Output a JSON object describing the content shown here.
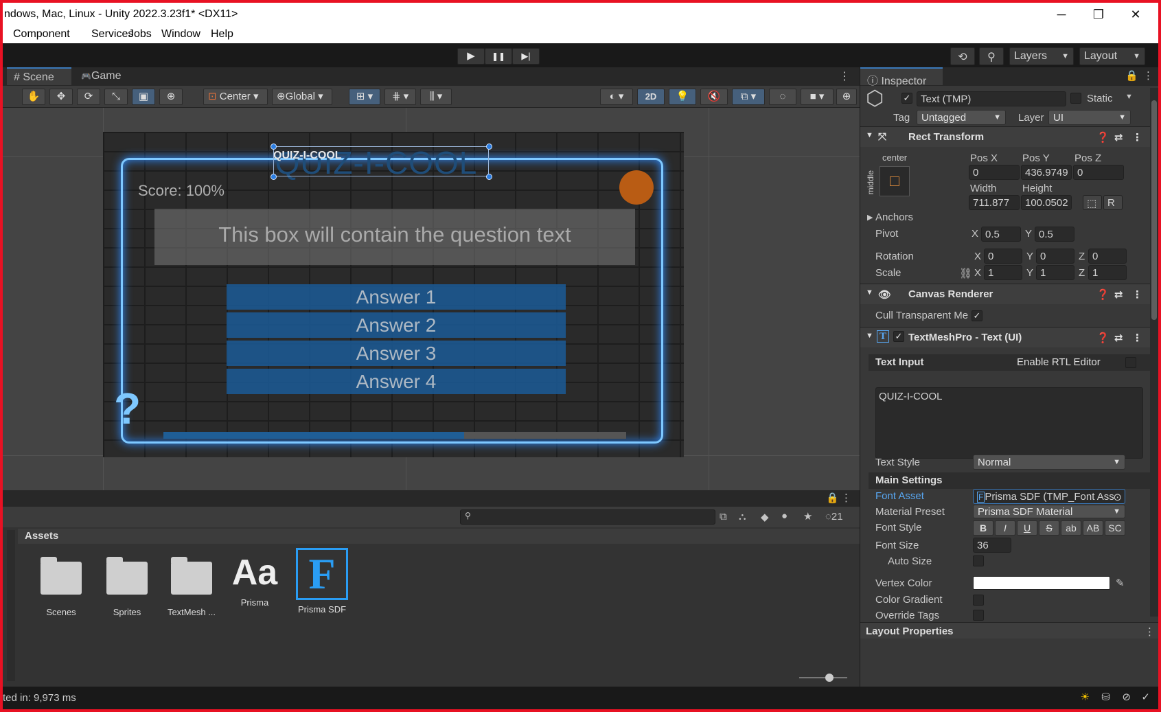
{
  "window": {
    "title": "ndows, Mac, Linux - Unity 2022.3.23f1* <DX11>",
    "minimize": "─",
    "maximize": "❐",
    "close": "✕"
  },
  "menu": [
    "Component",
    "Services",
    "Jobs",
    "Window",
    "Help"
  ],
  "toolbar": {
    "play": "▶",
    "pause": "❚❚",
    "step": "▶|",
    "history": "⟲",
    "search": "⚲",
    "layers": "Layers",
    "layout": "Layout"
  },
  "scene_tabs": [
    {
      "label": "Scene",
      "icon": "#"
    },
    {
      "label": "Game",
      "icon": "🎮"
    }
  ],
  "scene_toolbar": {
    "pivot": "Center",
    "space": "Global",
    "mode2d": "2D"
  },
  "game": {
    "title": "QUIZ-I-COOL",
    "logo": "QUIZ-I-COOL",
    "score": "Score: 100%",
    "question": "This box will contain the question text",
    "answers": [
      "Answer 1",
      "Answer 2",
      "Answer 3",
      "Answer 4"
    ],
    "qmark": "?",
    "progress": 0.65
  },
  "project": {
    "header": "Assets",
    "hidden_count": "21",
    "items": [
      "Scenes",
      "Sprites",
      "TextMesh ...",
      "Prisma",
      "Prisma SDF"
    ],
    "font_glyph": "Aa",
    "sdf_glyph": "F"
  },
  "status": {
    "text": "ted in: 9,973 ms"
  },
  "inspector": {
    "tab": "Inspector",
    "object_name": "Text (TMP)",
    "static_label": "Static",
    "tag_label": "Tag",
    "tag": "Untagged",
    "layer_label": "Layer",
    "layer": "UI",
    "rect": {
      "title": "Rect Transform",
      "anchor_h": "center",
      "anchor_v": "middle",
      "posx_l": "Pos X",
      "posy_l": "Pos Y",
      "posz_l": "Pos Z",
      "posx": "0",
      "posy": "436.9749",
      "posz": "0",
      "width_l": "Width",
      "height_l": "Height",
      "width": "711.877",
      "height": "100.0502",
      "r_btn": "R",
      "anchors": "Anchors",
      "pivot": "Pivot",
      "pivot_x": "0.5",
      "pivot_y": "0.5",
      "rotation": "Rotation",
      "rot_x": "0",
      "rot_y": "0",
      "rot_z": "0",
      "scale": "Scale",
      "scale_x": "1",
      "scale_y": "1",
      "scale_z": "1",
      "x": "X",
      "y": "Y",
      "z": "Z"
    },
    "canvas": {
      "title": "Canvas Renderer",
      "cull": "Cull Transparent Me"
    },
    "tmp": {
      "title": "TextMeshPro - Text (UI)",
      "text_input": "Text Input",
      "rtl": "Enable RTL Editor",
      "text": "QUIZ-I-COOL",
      "text_style_l": "Text Style",
      "text_style": "Normal",
      "main_settings": "Main Settings",
      "font_asset_l": "Font Asset",
      "font_asset": "Prisma SDF (TMP_Font Ass",
      "material_l": "Material Preset",
      "material": "Prisma SDF Material",
      "font_style_l": "Font Style",
      "styles": [
        "B",
        "I",
        "U",
        "S",
        "ab",
        "AB",
        "SC"
      ],
      "font_size_l": "Font Size",
      "font_size": "36",
      "auto_size": "Auto Size",
      "vertex_color": "Vertex Color",
      "color_gradient": "Color Gradient",
      "override_tags": "Override Tags",
      "layout_props": "Layout Properties"
    }
  }
}
